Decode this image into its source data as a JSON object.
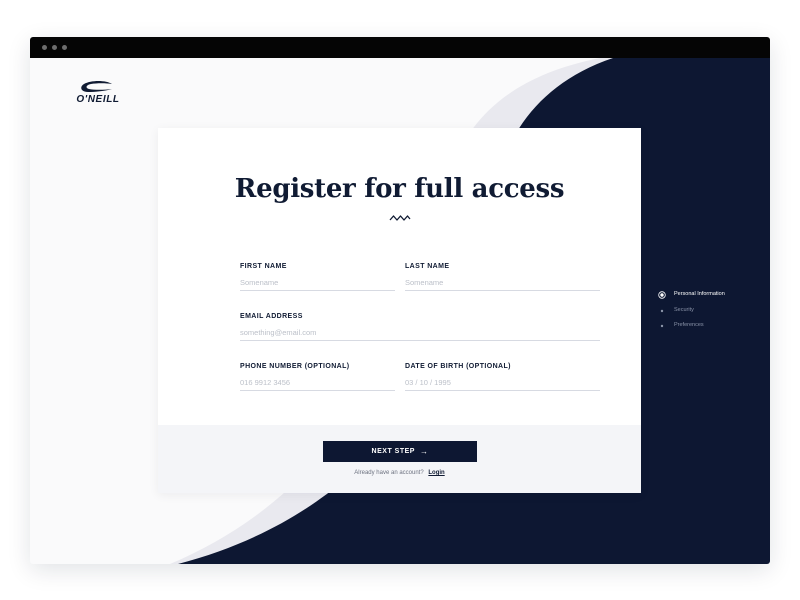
{
  "brand": {
    "logo_text": "O'NEILL"
  },
  "form": {
    "title": "Register for full access",
    "first_name": {
      "label": "FIRST NAME",
      "placeholder": "Somename"
    },
    "last_name": {
      "label": "LAST NAME",
      "placeholder": "Somename"
    },
    "email": {
      "label": "EMAIL ADDRESS",
      "placeholder": "something@email.com"
    },
    "phone": {
      "label": "PHONE NUMBER (OPTIONAL)",
      "placeholder": "016 9912 3456"
    },
    "dob": {
      "label": "DATE OF BIRTH (OPTIONAL)",
      "placeholder": "03 / 10 / 1995"
    },
    "next_button": "NEXT STEP",
    "next_icon": "arrow-right-icon",
    "login_prompt": "Already have an account?",
    "login_link": "Login"
  },
  "steps": [
    {
      "label": "Personal Information",
      "active": true
    },
    {
      "label": "Security",
      "active": false
    },
    {
      "label": "Preferences",
      "active": false
    }
  ],
  "colors": {
    "navy": "#0d1732",
    "background": "#fafafb",
    "swoosh": "#e9e9ef",
    "step_inactive": "#8a93a8"
  }
}
